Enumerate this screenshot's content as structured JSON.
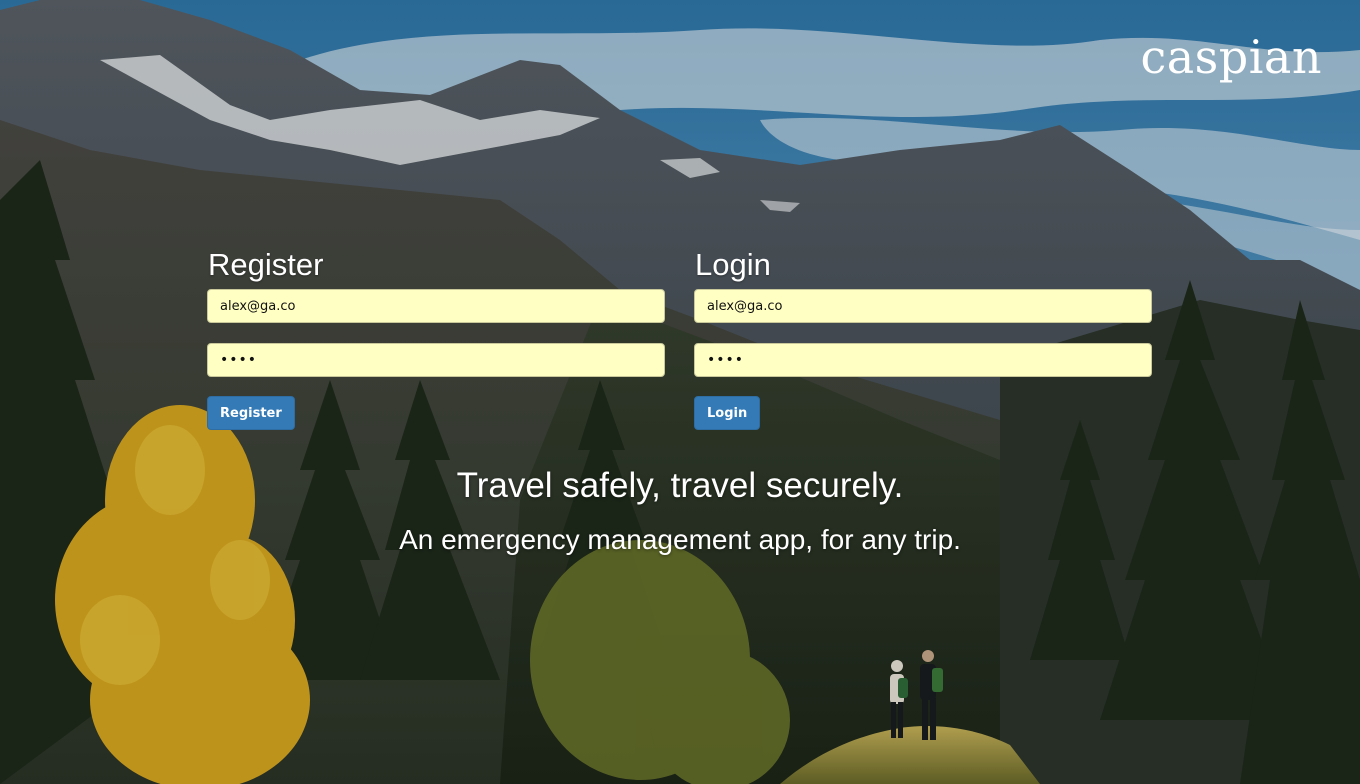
{
  "brand": {
    "logo_text": "caspian"
  },
  "register": {
    "title": "Register",
    "email_value": "alex@ga.co",
    "password_value": "alex",
    "button_label": "Register"
  },
  "login": {
    "title": "Login",
    "email_value": "alex@ga.co",
    "password_value": "alex",
    "button_label": "Login"
  },
  "hero": {
    "headline": "Travel safely, travel securely.",
    "subheadline": "An emergency management app, for any trip."
  },
  "colors": {
    "input_background": "#ffffc4",
    "button_primary": "#337ab7",
    "text_on_image": "#ffffff"
  }
}
